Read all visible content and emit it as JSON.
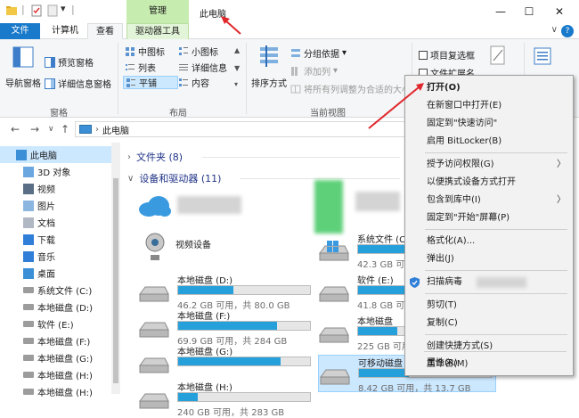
{
  "titlebar": {
    "manage_tab": "管理",
    "window_title": "此电脑",
    "minimize": "—",
    "maximize": "☐",
    "close": "✕"
  },
  "tabs": {
    "file": "文件",
    "computer": "计算机",
    "view": "查看",
    "drive_tools": "驱动器工具"
  },
  "ribbon": {
    "panes": {
      "nav_pane": "导航窗格",
      "preview_pane": "预览窗格",
      "details_pane": "详细信息窗格",
      "group_label": "窗格"
    },
    "layout": {
      "medium_icons": "中图标",
      "small_icons": "小图标",
      "list": "列表",
      "details": "详细信息",
      "tiles": "平铺",
      "content": "内容",
      "group_label": "布局"
    },
    "current_view": {
      "sort_by": "排序方式",
      "group_by": "分组依据",
      "add_columns": "添加列",
      "size_all_columns": "将所有列调整为合适的大小",
      "group_label": "当前视图"
    },
    "show_hide": {
      "item_checkboxes": "项目复选框",
      "file_extensions": "文件扩展名"
    }
  },
  "address": {
    "path": "此电脑"
  },
  "nav_pane": {
    "items": [
      {
        "label": "此电脑",
        "icon": "computer-icon"
      },
      {
        "label": "3D 对象",
        "icon": "3d-objects-icon"
      },
      {
        "label": "视频",
        "icon": "video-folder-icon"
      },
      {
        "label": "图片",
        "icon": "pictures-folder-icon"
      },
      {
        "label": "文档",
        "icon": "documents-folder-icon"
      },
      {
        "label": "下载",
        "icon": "downloads-folder-icon"
      },
      {
        "label": "音乐",
        "icon": "music-folder-icon"
      },
      {
        "label": "桌面",
        "icon": "desktop-folder-icon"
      },
      {
        "label": "系统文件 (C:)",
        "icon": "drive-icon"
      },
      {
        "label": "本地磁盘 (D:)",
        "icon": "drive-icon"
      },
      {
        "label": "软件 (E:)",
        "icon": "drive-icon"
      },
      {
        "label": "本地磁盘 (F:)",
        "icon": "drive-icon"
      },
      {
        "label": "本地磁盘 (G:)",
        "icon": "drive-icon"
      },
      {
        "label": "本地磁盘 (H:)",
        "icon": "drive-icon"
      },
      {
        "label": "本地磁盘 (H:)",
        "icon": "drive-icon"
      }
    ]
  },
  "content": {
    "folders_header": "文件夹 (8)",
    "devices_header": "设备和驱动器 (11)",
    "video_device": "视频设备",
    "drives_left": [
      {
        "name": "本地磁盘 (D:)",
        "size": "46.2 GB 可用，共 80.0 GB",
        "used": 0.42
      },
      {
        "name": "本地磁盘 (F:)",
        "size": "69.9 GB 可用，共 284 GB",
        "used": 0.75
      },
      {
        "name": "本地磁盘 (G:)",
        "size": "",
        "used": 0.78
      },
      {
        "name": "本地磁盘 (H:)",
        "size": "240 GB 可用，共 283 GB",
        "used": 0.15
      }
    ],
    "drives_right": [
      {
        "name": "系统文件 (C:)",
        "size": "42.3 GB 可用，共",
        "used": 0.7
      },
      {
        "name": "软件 (E:)",
        "size": "41.8 GB 可用，共",
        "used": 0.7
      },
      {
        "name": "本地磁盘",
        "size": "225 GB 可用，共",
        "used": 0.3
      },
      {
        "name": "可移动磁盘",
        "size": "8.42 GB 可用，共 13.7 GB",
        "used": 0.38
      }
    ]
  },
  "context_menu": {
    "open": "打开(O)",
    "open_new_window": "在新窗口中打开(E)",
    "pin_quick_access": "固定到\"快速访问\"",
    "bitlocker": "启用 BitLocker(B)",
    "grant_access": "授予访问权限(G)",
    "open_as_portable": "以便携式设备方式打开",
    "include_in_library": "包含到库中(I)",
    "pin_start": "固定到\"开始\"屏幕(P)",
    "format": "格式化(A)...",
    "eject": "弹出(J)",
    "scan_virus": "扫描病毒",
    "cut": "剪切(T)",
    "copy": "复制(C)",
    "create_shortcut": "创建快捷方式(S)",
    "rename": "重命名(M)",
    "properties": "属性(R)"
  },
  "colors": {
    "accent": "#1979ca",
    "manage_green": "#c7ecb0",
    "drive_bar": "#26a0da",
    "annotation_red": "#e0262b"
  }
}
